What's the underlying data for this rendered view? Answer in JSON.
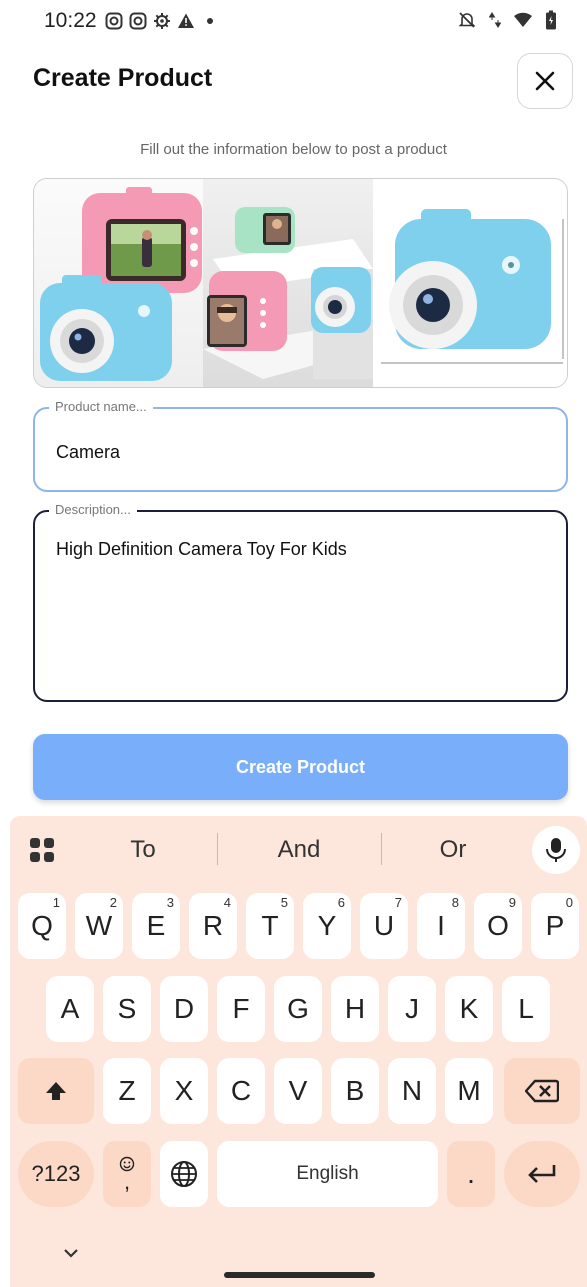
{
  "status_bar": {
    "time": "10:22",
    "left_icons": [
      "instagram-icon",
      "instagram-icon",
      "settings-icon",
      "warning-icon",
      "dot-icon"
    ],
    "right_icons": [
      "mute-icon",
      "data-arrows-icon",
      "wifi-icon",
      "battery-icon"
    ]
  },
  "header": {
    "title": "Create Product",
    "close_icon": "close-icon"
  },
  "subtitle": "Fill out the information below to post a product",
  "images": {
    "count": 3
  },
  "product_name": {
    "label": "Product name...",
    "value": "Camera"
  },
  "description": {
    "label": "Description...",
    "value": "High Definition Camera Toy For Kids"
  },
  "submit_label": "Create Product",
  "keyboard": {
    "suggestions": [
      "To",
      "And",
      "Or"
    ],
    "row1": [
      {
        "key": "Q",
        "hint": "1"
      },
      {
        "key": "W",
        "hint": "2"
      },
      {
        "key": "E",
        "hint": "3"
      },
      {
        "key": "R",
        "hint": "4"
      },
      {
        "key": "T",
        "hint": "5"
      },
      {
        "key": "Y",
        "hint": "6"
      },
      {
        "key": "U",
        "hint": "7"
      },
      {
        "key": "I",
        "hint": "8"
      },
      {
        "key": "O",
        "hint": "9"
      },
      {
        "key": "P",
        "hint": "0"
      }
    ],
    "row2": [
      "A",
      "S",
      "D",
      "F",
      "G",
      "H",
      "J",
      "K",
      "L"
    ],
    "row3": [
      "Z",
      "X",
      "C",
      "V",
      "B",
      "N",
      "M"
    ],
    "symbols_label": "?123",
    "emoji_comma": ",",
    "space_label": "English",
    "period_label": ".",
    "colors": {
      "background": "#fde7dc",
      "special_key": "#fbd9c6",
      "key": "#ffffff"
    }
  },
  "colors": {
    "primary_button": "#79aefa",
    "focused_border": "#8db4ee",
    "active_border": "#1d1f3a"
  }
}
